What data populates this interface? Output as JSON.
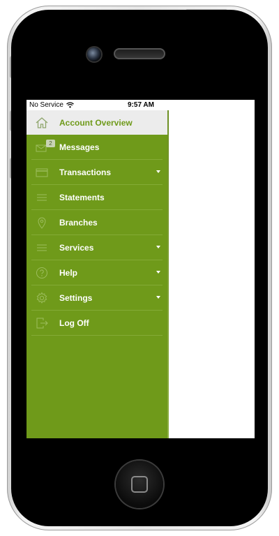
{
  "status_bar": {
    "carrier": "No Service",
    "time": "9:57 AM"
  },
  "menu": {
    "items": [
      {
        "label": "Account Overview",
        "icon": "home-icon",
        "active": true,
        "has_submenu": false
      },
      {
        "label": "Messages",
        "icon": "mail-icon",
        "badge": "2",
        "active": false,
        "has_submenu": false
      },
      {
        "label": "Transactions",
        "icon": "card-icon",
        "active": false,
        "has_submenu": true
      },
      {
        "label": "Statements",
        "icon": "list-icon",
        "active": false,
        "has_submenu": false
      },
      {
        "label": "Branches",
        "icon": "location-pin-icon",
        "active": false,
        "has_submenu": false
      },
      {
        "label": "Services",
        "icon": "list-icon",
        "active": false,
        "has_submenu": true
      },
      {
        "label": "Help",
        "icon": "help-icon",
        "active": false,
        "has_submenu": true
      },
      {
        "label": "Settings",
        "icon": "gear-icon",
        "active": false,
        "has_submenu": true
      },
      {
        "label": "Log Off",
        "icon": "logout-icon",
        "active": false,
        "has_submenu": false
      }
    ]
  },
  "colors": {
    "drawer_green": "#6f9a1a",
    "active_bg": "#ececec",
    "active_text": "#6f9a1a",
    "divider": "#84ab36"
  }
}
